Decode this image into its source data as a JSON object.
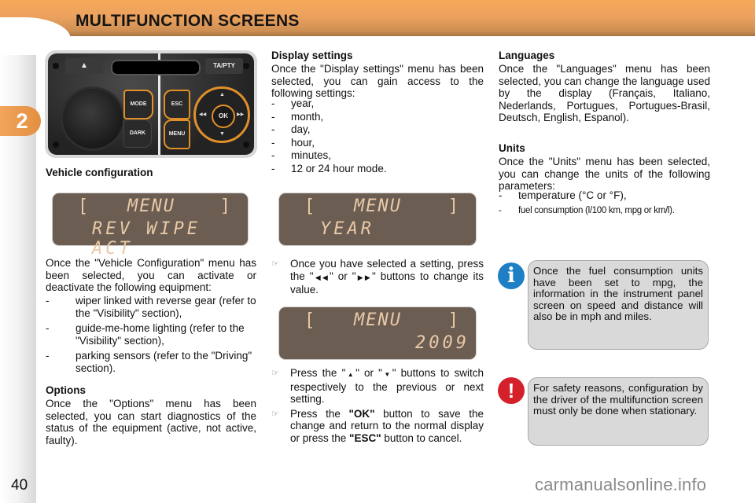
{
  "header": {
    "title": "MULTIFUNCTION SCREENS"
  },
  "chapter": {
    "number": "2"
  },
  "page": {
    "number": "40"
  },
  "control_panel": {
    "buttons": {
      "eject": "▲",
      "ta_pty": "TA/PTY",
      "mode": "MODE",
      "dark": "DARK",
      "esc": "ESC",
      "menu": "MENU",
      "ok": "OK",
      "up": "▲",
      "down": "▼",
      "left": "◀◀",
      "right": "▶▶"
    }
  },
  "vehicle_configuration": {
    "heading": "Vehicle configuration",
    "screen": {
      "left_bracket": "[",
      "menu": "MENU",
      "right_bracket": "]",
      "line2": "REV WIPE ACT"
    },
    "intro": "Once the \"Vehicle Configuration\" menu has been selected, you can activate or deactivate the following equipment:",
    "items": [
      "wiper linked with reverse gear (refer to the \"Visibility\" section),",
      "guide-me-home lighting (refer to the \"Visibility\" section),",
      "parking sensors (refer to the \"Driving\" section)."
    ]
  },
  "options": {
    "heading": "Options",
    "text": "Once the \"Options\" menu has been selected, you can start diagnostics of the status of the equipment (active, not active, faulty)."
  },
  "display_settings": {
    "heading": "Display settings",
    "intro": "Once the \"Display settings\" menu has been selected, you can gain access to the following settings:",
    "items": [
      "year,",
      "month,",
      "day,",
      "hour,",
      "minutes,",
      "12 or 24 hour mode."
    ],
    "screen_year": {
      "left_bracket": "[",
      "menu": "MENU",
      "right_bracket": "]",
      "line2": "YEAR"
    },
    "tip_change": {
      "before": "Once you have selected a setting, press the \"",
      "sym1": "◀◀",
      "mid": "\" or \"",
      "sym2": "▶▶",
      "after": "\" buttons to change its value."
    },
    "screen_value": {
      "left_bracket": "[",
      "menu": "MENU",
      "right_bracket": "]",
      "line2": "2009"
    },
    "tip_navigate": {
      "before": "Press the \"",
      "sym1": "▲",
      "mid": "\" or \"",
      "sym2": "▼",
      "after": "\" buttons to switch respectively to the previous or next setting."
    },
    "tip_save": {
      "before": "Press the ",
      "ok": "\"OK\"",
      "mid": " button to save the change and return to the normal display or press the ",
      "esc": "\"ESC\"",
      "after": " button to cancel."
    }
  },
  "languages": {
    "heading": "Languages",
    "text": "Once the \"Languages\" menu has been selected, you can change the language used by the display (Français, Italiano, Nederlands, Portugues, Portugues-Brasil, Deutsch, English, Espanol)."
  },
  "units": {
    "heading": "Units",
    "intro": "Once the \"Units\" menu has been selected, you can change the units of the following parameters:",
    "items": [
      "temperature (°C or °F),",
      "fuel consumption (l/100 km, mpg or km/l)."
    ]
  },
  "notices": {
    "info": {
      "icon": "i",
      "text": "Once the fuel consumption units have been set to mpg, the information in the instrument panel screen on speed and distance will also be in mph and miles."
    },
    "warning": {
      "icon": "!",
      "text": "For safety reasons, configuration by the driver of the multifunction screen must only be done when stationary."
    }
  },
  "bullet_symbol": "☞",
  "watermark": "carmanualsonline.info",
  "colors": {
    "accent": "#f0a25c",
    "lcd_bg": "#6b5d52",
    "lcd_text": "#e9c9a8",
    "info_blue": "#1e7fc4",
    "warning_red": "#d4202a",
    "notice_bg": "#d9d9d9"
  }
}
